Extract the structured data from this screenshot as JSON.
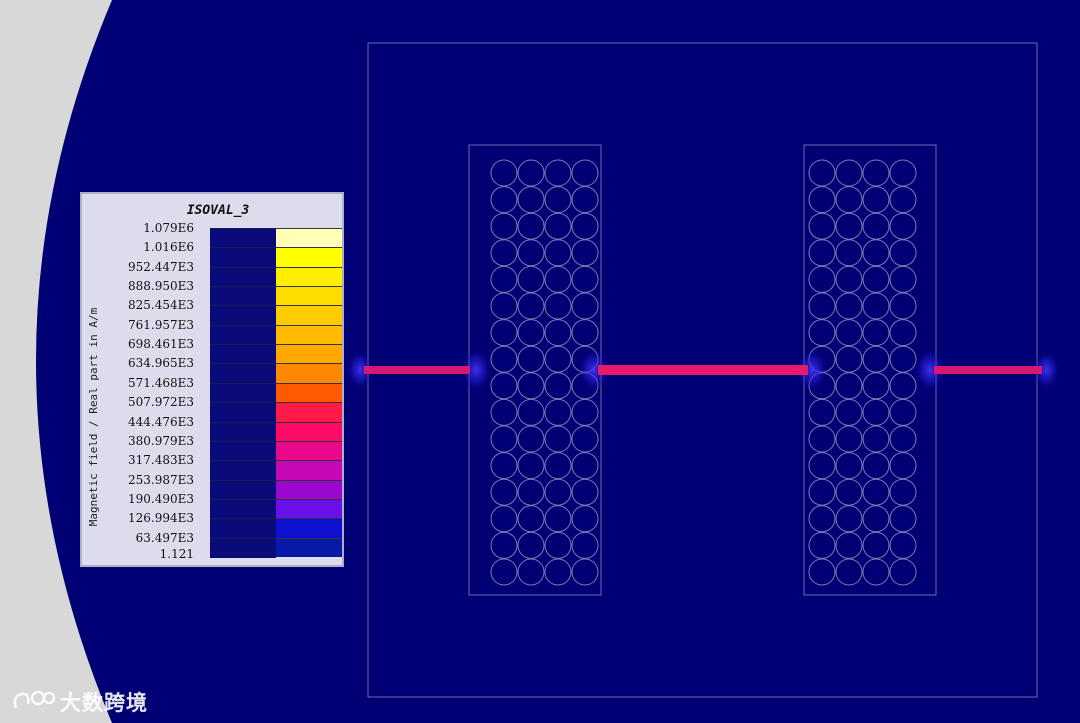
{
  "colors": {
    "background": "#000074",
    "outer_region": "#d8d8d8",
    "outline": "#8a8ab8",
    "conductor": "#d81870",
    "conductor_core": "#e8206a"
  },
  "legend": {
    "title": "ISOVAL_3",
    "quantity_label": "Magnetic field / Real part in A/m",
    "ticks": [
      "1.079E6",
      "1.016E6",
      "952.447E3",
      "888.950E3",
      "825.454E3",
      "761.957E3",
      "698.461E3",
      "634.965E3",
      "571.468E3",
      "507.972E3",
      "444.476E3",
      "380.979E3",
      "317.483E3",
      "253.987E3",
      "190.490E3",
      "126.994E3",
      "63.497E3",
      "1.121"
    ],
    "band_colors": [
      "#ffffb8",
      "#ffff00",
      "#ffee00",
      "#ffdd00",
      "#ffcc00",
      "#ffbb00",
      "#ffa800",
      "#ff8800",
      "#ff5a00",
      "#ff1a4a",
      "#ff0a68",
      "#e8088c",
      "#c608b8",
      "#9a08d0",
      "#6a10e8",
      "#1010d0",
      "#0a1aa8"
    ]
  },
  "coils": {
    "left": {
      "columns": 4,
      "rows": 16
    },
    "right": {
      "columns": 4,
      "rows": 16
    }
  },
  "watermark": {
    "text": "大数跨境",
    "logo": "infinity-logo-icon"
  }
}
